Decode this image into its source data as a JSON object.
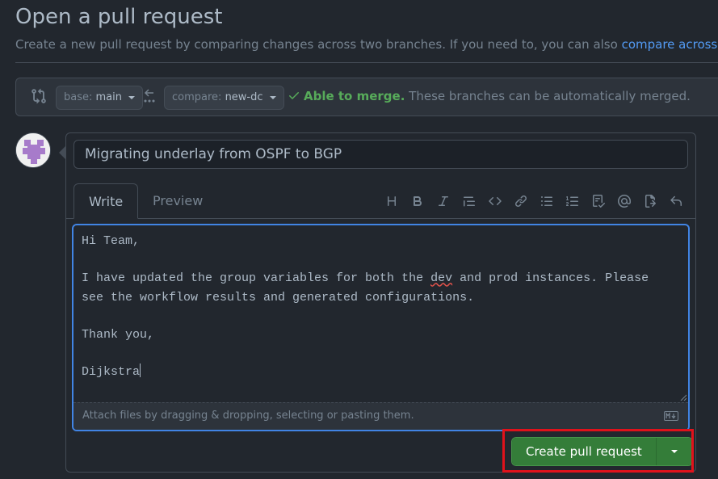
{
  "page": {
    "title": "Open a pull request",
    "subtitle_text": "Create a new pull request by comparing changes across two branches. If you need to, you can also ",
    "subtitle_link": "compare across forks"
  },
  "merge_bar": {
    "base_label": "base:",
    "base_value": "main",
    "compare_label": "compare:",
    "compare_value": "new-dc",
    "status_ok": "Able to merge.",
    "status_desc": "These branches can be automatically merged."
  },
  "form": {
    "title_value": "Migrating underlay from OSPF to BGP",
    "tabs": [
      {
        "label": "Write",
        "active": true
      },
      {
        "label": "Preview",
        "active": false
      }
    ],
    "toolbar_icons": [
      "heading-icon",
      "bold-icon",
      "italic-icon",
      "quote-icon",
      "code-icon",
      "link-icon",
      "bulleted-list-icon",
      "numbered-list-icon",
      "task-list-icon",
      "mention-icon",
      "cross-reference-icon",
      "reply-icon"
    ],
    "body": {
      "line1": "Hi Team,",
      "line2_pre": "I have updated the group variables for both the ",
      "line2_spell": "dev",
      "line2_post": " and prod instances. Please\nsee the workflow results and generated configurations.",
      "line3": "Thank you,",
      "line4": "Dijkstra"
    },
    "attach_hint": "Attach files by dragging & dropping, selecting or pasting them.",
    "markdown_icon": "markdown-icon",
    "create_button": "Create pull request"
  },
  "colors": {
    "background": "#22272e",
    "accent_link": "#539bf5",
    "success": "#57ab5a",
    "create_button": "#347d39",
    "highlight_box": "#e0121b"
  }
}
